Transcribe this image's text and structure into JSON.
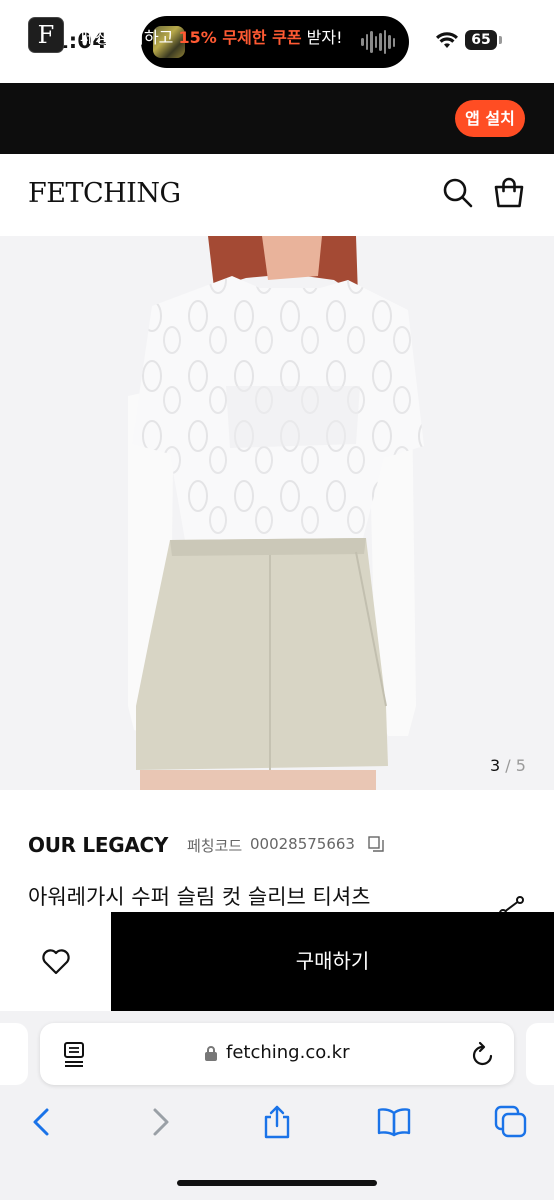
{
  "status_bar": {
    "time": "1:04",
    "battery": "65"
  },
  "promo": {
    "logo_letter": "F",
    "text_before": "페칭 설치하고 ",
    "text_highlight": "15% 무제한 쿠폰",
    "text_after": " 받자!",
    "button_label": "앱 설치",
    "accent": "#ff4d23"
  },
  "header": {
    "logo": "FETCHING"
  },
  "gallery": {
    "current": "3",
    "separator": " / ",
    "total": "5"
  },
  "product": {
    "brand": "OUR LEGACY",
    "code_label": "페칭코드",
    "code_value": "00028575663",
    "name": "아워레가시 수퍼 슬림 컷 슬리브 티셔츠"
  },
  "buy_bar": {
    "buy_label": "구매하기"
  },
  "browser": {
    "url": "fetching.co.kr"
  },
  "icons": [
    "search-icon",
    "bag-icon",
    "copy-icon",
    "share-icon",
    "heart-icon",
    "reader-icon",
    "lock-icon",
    "reload-icon",
    "back-icon",
    "forward-icon",
    "share-sheet-icon",
    "bookmarks-icon",
    "tabs-icon"
  ]
}
